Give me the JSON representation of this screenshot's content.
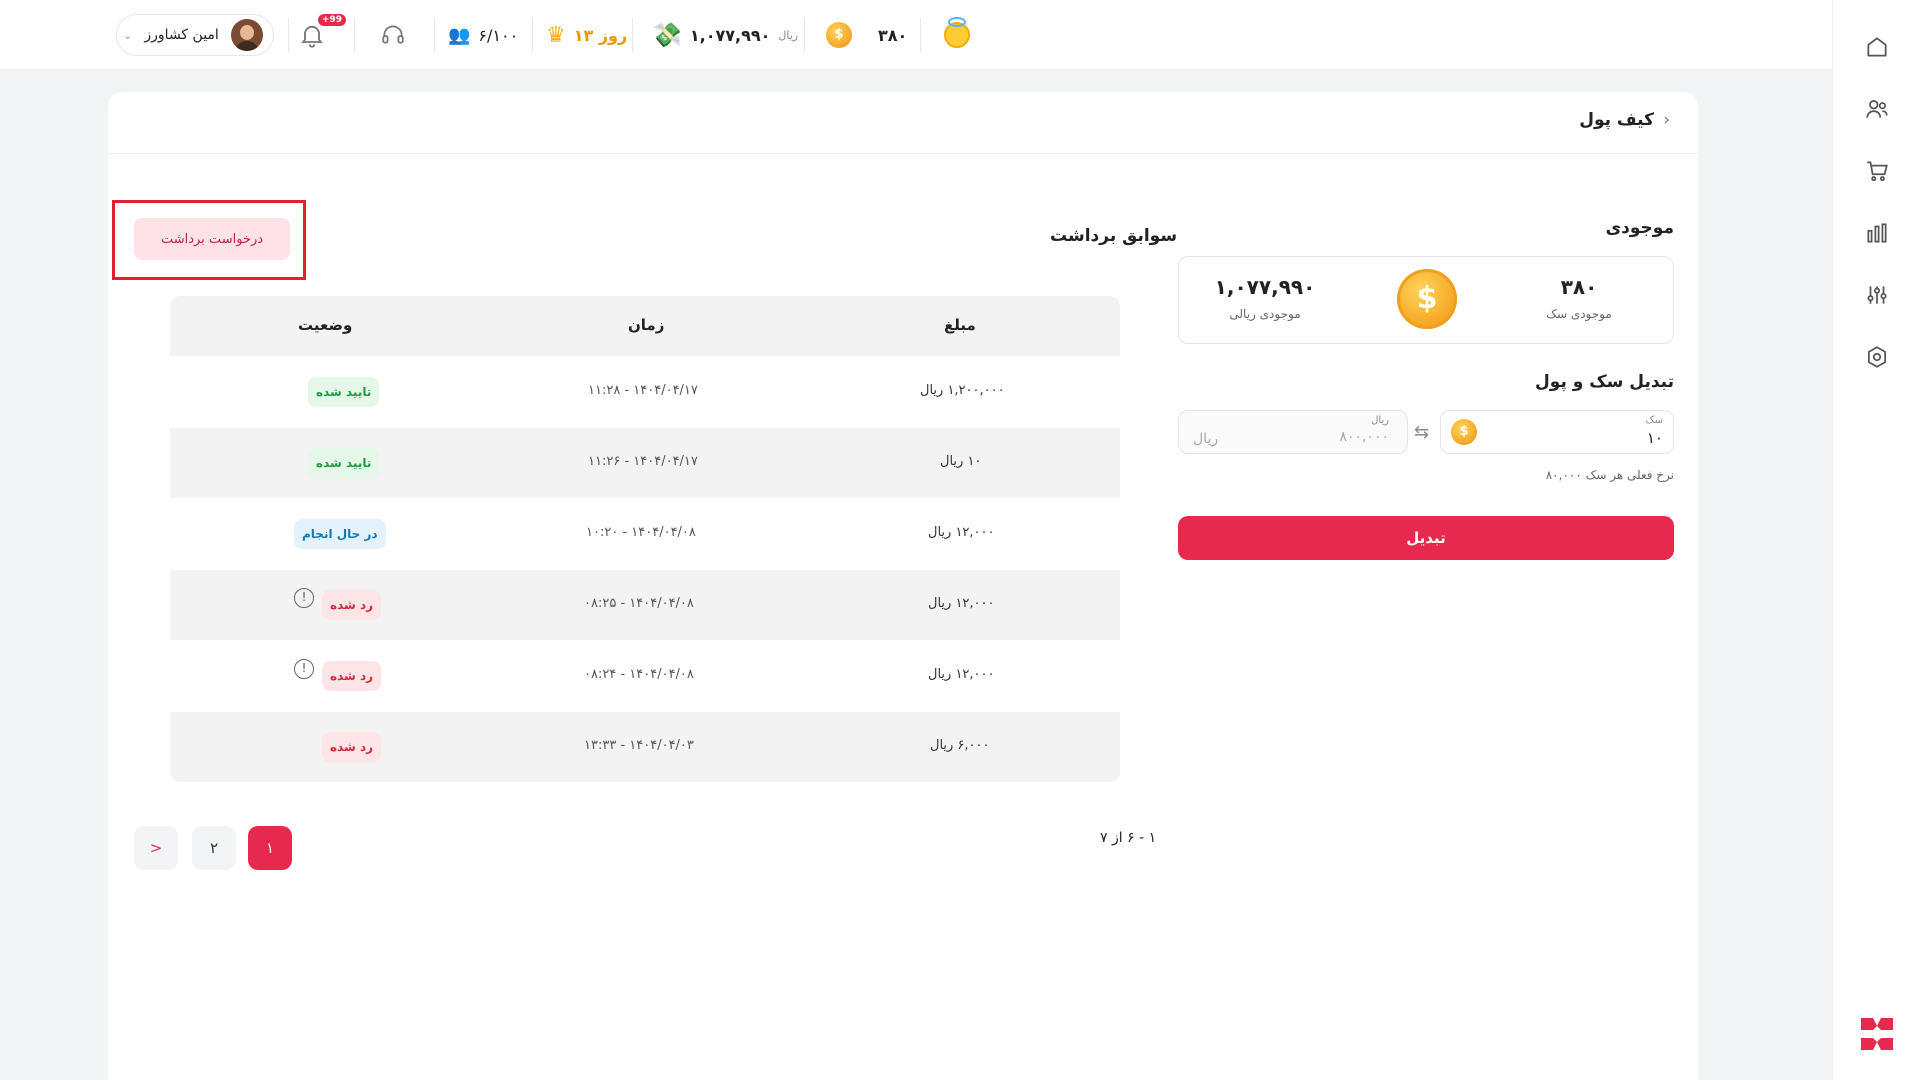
{
  "header": {
    "user_name": "امین کشاورز",
    "notifications_badge": "+99",
    "players": "۶/۱۰۰",
    "subscription": "۱۳ روز",
    "wallet_balance": "۱,۰۷۷,۹۹۰",
    "wallet_unit": "ریال",
    "coins": "۳۸۰"
  },
  "page": {
    "title": "کیف پول"
  },
  "balance": {
    "title": "موجودی",
    "rial_value": "۱,۰۷۷,۹۹۰",
    "rial_label": "موجودی ریالی",
    "coin_value": "۳۸۰",
    "coin_label": "موجودی سک"
  },
  "conversion": {
    "title": "تبدیل سک و پول",
    "coin_label": "سک",
    "coin_value": "۱۰",
    "rial_label": "ریال",
    "rial_placeholder": "ریال",
    "rial_value": "۸۰۰,۰۰۰",
    "rate_text": "نرخ فعلی هر سک ۸۰,۰۰۰",
    "button": "تبدیل"
  },
  "history": {
    "title": "سوابق برداشت",
    "request_button": "درخواست برداشت",
    "columns": {
      "amount": "مبلغ",
      "time": "زمان",
      "status": "وضعیت"
    },
    "rows": [
      {
        "amount": "۱,۲۰۰,۰۰۰ ریال",
        "time": "۱۴۰۴/۰۴/۱۷ - ۱۱:۲۸",
        "status": "تایید شده"
      },
      {
        "amount": "۱۰ ریال",
        "time": "۱۴۰۴/۰۴/۱۷ - ۱۱:۲۶",
        "status": "تایید شده"
      },
      {
        "amount": "۱۲,۰۰۰ ریال",
        "time": "۱۴۰۴/۰۴/۰۸ - ۱۰:۲۰",
        "status": "در حال انجام"
      },
      {
        "amount": "۱۲,۰۰۰ ریال",
        "time": "۱۴۰۴/۰۴/۰۸ - ۰۸:۲۵",
        "status": "رد شده"
      },
      {
        "amount": "۱۲,۰۰۰ ریال",
        "time": "۱۴۰۴/۰۴/۰۸ - ۰۸:۲۴",
        "status": "رد شده"
      },
      {
        "amount": "۶,۰۰۰ ریال",
        "time": "۱۴۰۴/۰۴/۰۳ - ۱۳:۳۳",
        "status": "رد شده"
      }
    ],
    "pagination": {
      "summary": "۱ - ۶ از ۷",
      "pages": [
        "۱",
        "۲"
      ],
      "next": ">"
    }
  },
  "colors": {
    "accent": "#e8294e",
    "success": "#1f9b45",
    "progress": "#1478b8",
    "danger": "#d22b3e"
  },
  "icons": {
    "sidebar": [
      "home-icon",
      "users-icon",
      "cart-icon",
      "chart-icon",
      "sliders-icon",
      "settings-icon"
    ]
  }
}
